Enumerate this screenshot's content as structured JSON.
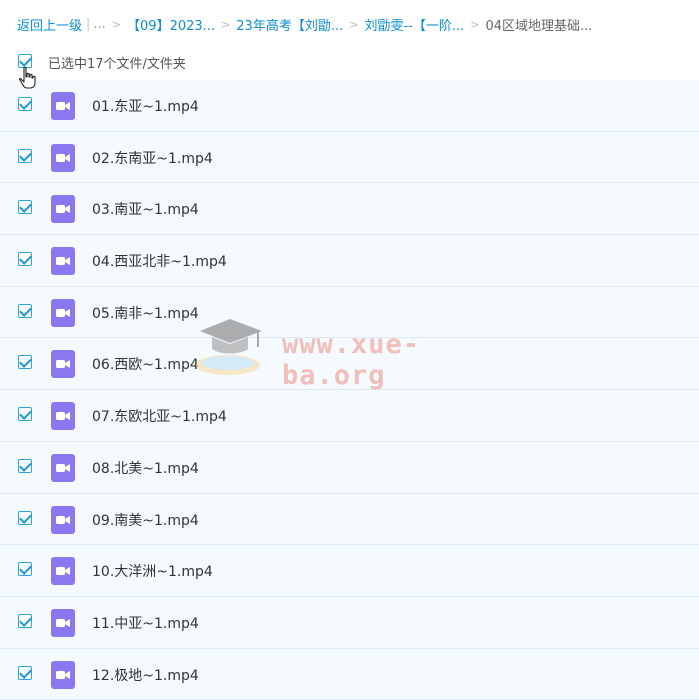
{
  "breadcrumb": {
    "back": "返回上一级",
    "more": "...",
    "items": [
      "【09】2023...",
      "23年高考【刘勖...",
      "刘勖雯--【一阶..."
    ],
    "current": "04区域地理基础..."
  },
  "selection": {
    "label": "已选中17个文件/文件夹",
    "checked": true
  },
  "files": [
    {
      "name": "01.东亚~1.mp4",
      "checked": true
    },
    {
      "name": "02.东南亚~1.mp4",
      "checked": true
    },
    {
      "name": "03.南亚~1.mp4",
      "checked": true
    },
    {
      "name": "04.西亚北非~1.mp4",
      "checked": true
    },
    {
      "name": "05.南非~1.mp4",
      "checked": true
    },
    {
      "name": "06.西欧~1.mp4",
      "checked": true
    },
    {
      "name": "07.东欧北亚~1.mp4",
      "checked": true
    },
    {
      "name": "08.北美~1.mp4",
      "checked": true
    },
    {
      "name": "09.南美~1.mp4",
      "checked": true
    },
    {
      "name": "10.大洋洲~1.mp4",
      "checked": true
    },
    {
      "name": "11.中亚~1.mp4",
      "checked": true
    },
    {
      "name": "12.极地~1.mp4",
      "checked": true
    }
  ],
  "watermark": "www.xue-ba.org",
  "colors": {
    "link": "#0a8ed8",
    "checkbox": "#1a9ad6",
    "row_bg": "#f5faff",
    "video_icon": "#8b78f0"
  },
  "icons": {
    "file": "video-file-icon",
    "cursor": "hand-cursor-icon",
    "watermark_logo": "graduation-cap-icon"
  }
}
